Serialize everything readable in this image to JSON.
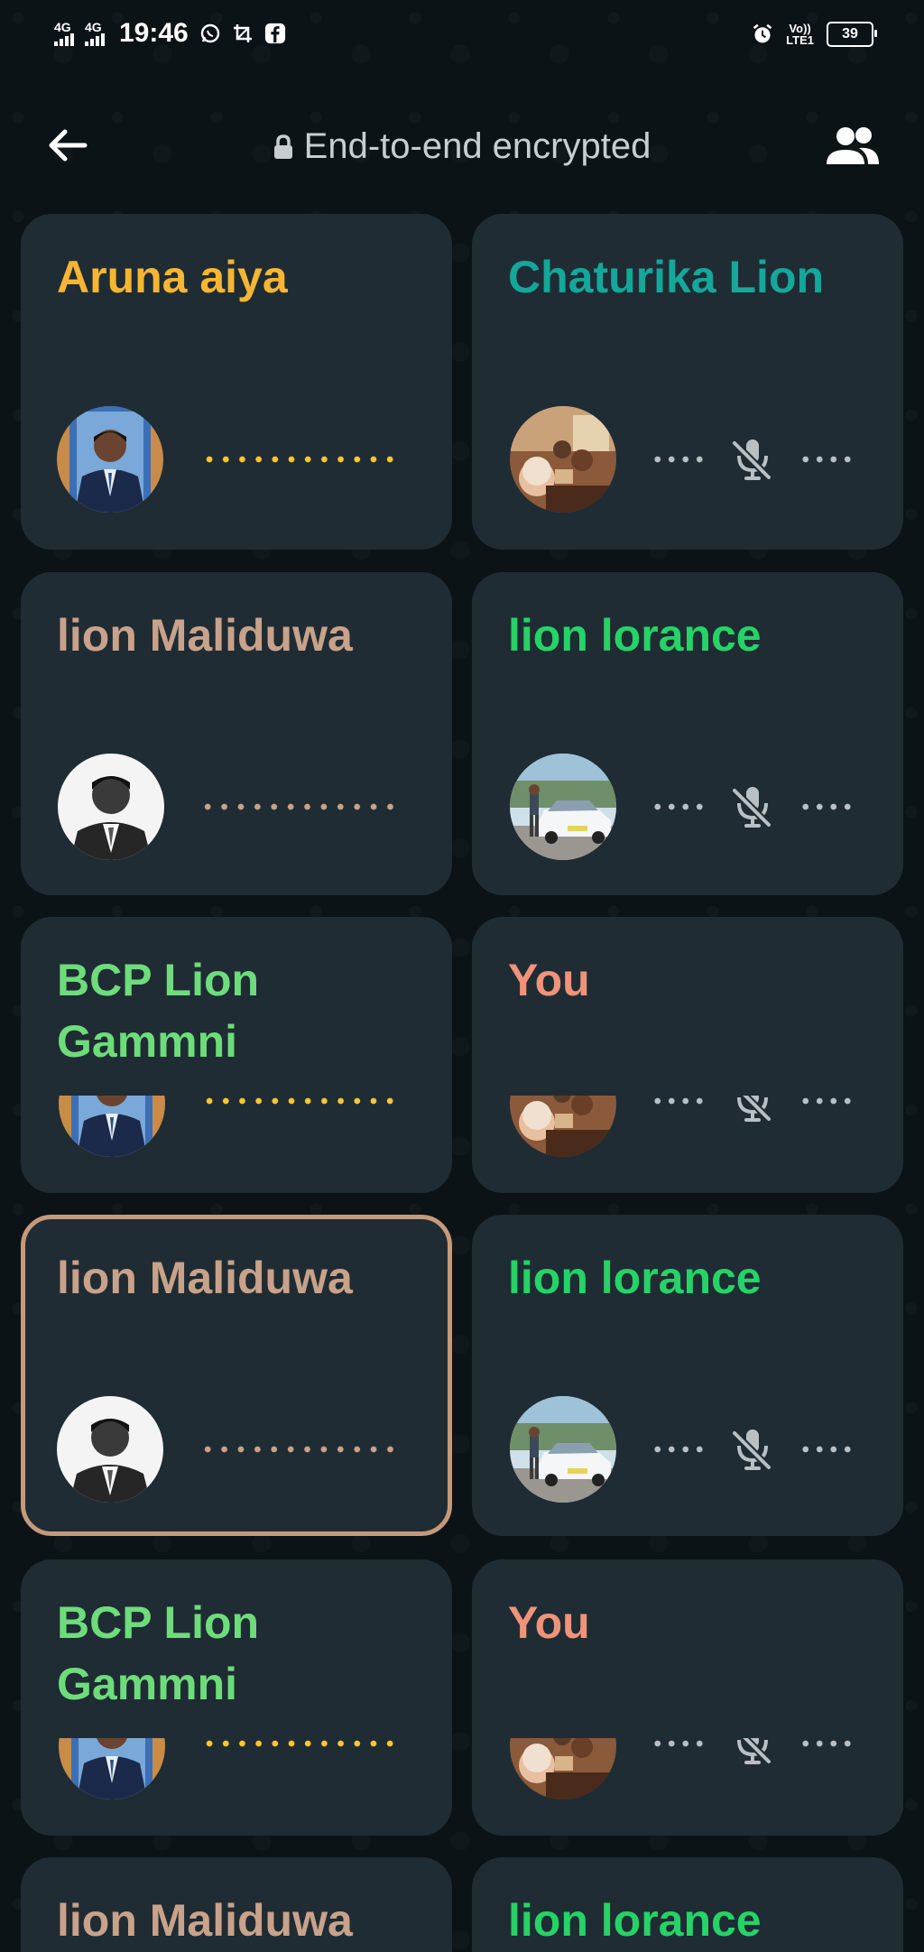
{
  "status_bar": {
    "network_1": "4G",
    "network_2": "4G",
    "time": "19:46",
    "volte_line1": "Vo))",
    "volte_line2": "LTE1",
    "battery": "39",
    "icons": [
      "whatsapp-icon",
      "screenshot-icon",
      "facebook-icon",
      "alarm-icon"
    ]
  },
  "header": {
    "back_icon": "arrow-left-icon",
    "encrypted_label": "End-to-end encrypted",
    "lock_icon": "lock-icon",
    "participants_icon": "people-icon"
  },
  "colors": {
    "background": "#0c1317",
    "tile": "#1f2c34",
    "active_border": "#c59a7a",
    "dots_yellow": "#ffc633",
    "dots_gray": "#b9c0c4",
    "name_orange": "#f6b633",
    "name_teal": "#14a79a",
    "name_tan": "#c8a28a",
    "name_green": "#25d366",
    "name_lightgreen": "#6edc7b",
    "name_salmon": "#f0937a"
  },
  "participants": [
    {
      "name": "Aruna aiya",
      "avatar": "avatar-man-suit",
      "muted": false,
      "active": false
    },
    {
      "name": "Chaturika Lion",
      "avatar": "avatar-group-selfie",
      "muted": true,
      "active": false
    },
    {
      "name": "lion Maliduwa",
      "avatar": "avatar-man-bw",
      "muted": false,
      "active": false
    },
    {
      "name": "lion lorance",
      "avatar": "avatar-car",
      "muted": true,
      "active": false
    },
    {
      "name_line1": "BCP Lion",
      "name_line2": "Gammni",
      "avatar": "avatar-man-suit",
      "muted": false,
      "active": false
    },
    {
      "name": "You",
      "avatar": "avatar-group-selfie",
      "muted": true,
      "active": false
    },
    {
      "name": "lion Maliduwa",
      "avatar": "avatar-man-bw",
      "muted": false,
      "active": true
    },
    {
      "name": "lion lorance",
      "avatar": "avatar-car",
      "muted": true,
      "active": false
    },
    {
      "name_line1": "BCP Lion",
      "name_line2": "Gammni",
      "avatar": "avatar-man-suit",
      "muted": false,
      "active": false
    },
    {
      "name": "You",
      "avatar": "avatar-group-selfie",
      "muted": true,
      "active": false
    },
    {
      "name": "lion Maliduwa",
      "avatar": "avatar-man-bw",
      "muted": false,
      "active": false
    },
    {
      "name": "lion lorance",
      "avatar": "avatar-car",
      "muted": true,
      "active": false
    }
  ]
}
